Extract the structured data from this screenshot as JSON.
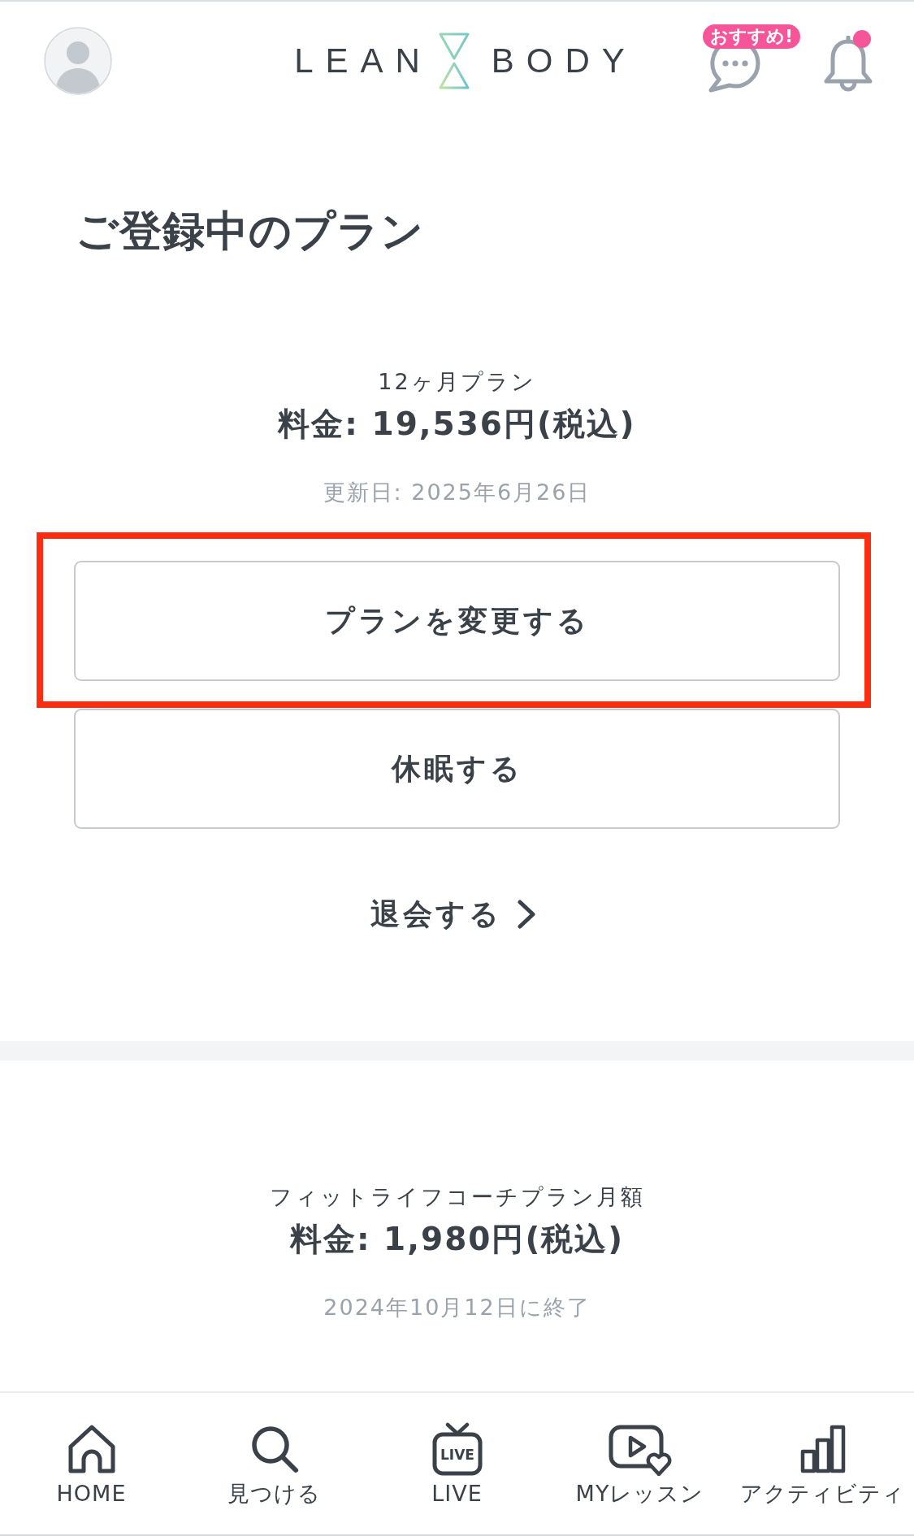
{
  "header": {
    "logo": {
      "left": "LEAN",
      "right": "BODY"
    },
    "chat_badge": "おすすめ!",
    "notifications": {
      "unread": true
    }
  },
  "page_title": "ご登録中のプラン",
  "current_plan": {
    "name": "12ヶ月プラン",
    "price": "料金: 19,536円(税込)",
    "date": "更新日: 2025年6月26日"
  },
  "actions": [
    {
      "label": "プランを変更する",
      "highlighted": true
    },
    {
      "label": "休眠する",
      "highlighted": false
    }
  ],
  "cancel_link": {
    "label": "退会する"
  },
  "past_plans": [
    {
      "name": "フィットライフコーチプラン月額",
      "price": "料金: 1,980円(税込)",
      "date": "2024年10月12日に終了"
    }
  ],
  "bottom_nav": [
    {
      "kind": "home",
      "label": "HOME"
    },
    {
      "kind": "search",
      "label": "見つける"
    },
    {
      "kind": "live",
      "label": "LIVE",
      "icon_text": "LIVE"
    },
    {
      "kind": "lessons",
      "label": "MYレッスン"
    },
    {
      "kind": "activity",
      "label": "アクティビティ"
    }
  ]
}
